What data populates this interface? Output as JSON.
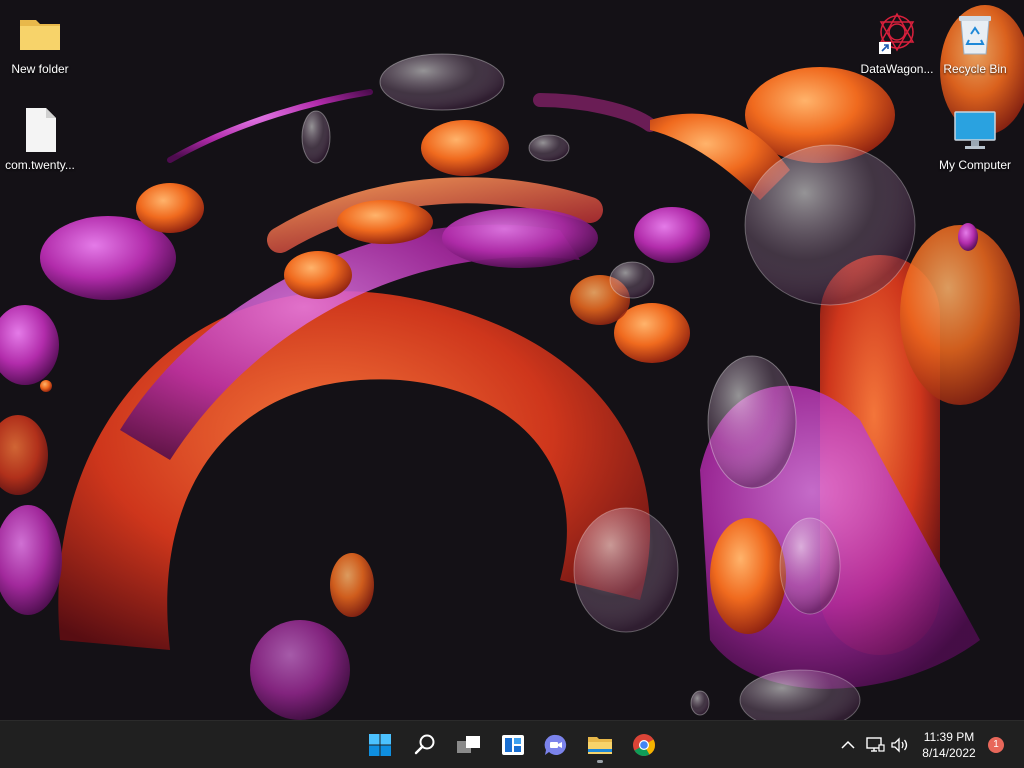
{
  "desktop": {
    "wallpaper": "Windows 11 Bloom (dark)",
    "icons": [
      {
        "label": "New folder",
        "icon": "folder-icon"
      },
      {
        "label": "com.twenty...",
        "icon": "file-icon"
      },
      {
        "label": "DataWagon...",
        "icon": "datawagon-shortcut-icon"
      },
      {
        "label": "Recycle Bin",
        "icon": "recycle-bin-icon"
      },
      {
        "label": "My Computer",
        "icon": "monitor-icon"
      }
    ]
  },
  "taskbar": {
    "apps": [
      {
        "name": "Start",
        "icon": "windows-start-icon"
      },
      {
        "name": "Search",
        "icon": "search-icon"
      },
      {
        "name": "Task View",
        "icon": "task-view-icon"
      },
      {
        "name": "Widgets",
        "icon": "widgets-icon"
      },
      {
        "name": "Chat",
        "icon": "chat-icon"
      },
      {
        "name": "File Explorer",
        "icon": "file-explorer-icon",
        "running": true
      },
      {
        "name": "Google Chrome",
        "icon": "chrome-icon"
      }
    ],
    "tray": {
      "icons": [
        "chevron-up-icon",
        "network-icon",
        "volume-icon"
      ],
      "time": "11:39 PM",
      "date": "8/14/2022",
      "notification_count": "1"
    }
  },
  "colors": {
    "taskbar_bg": "#202020",
    "accent_blue": "#0078d4",
    "badge": "#e8675a"
  }
}
